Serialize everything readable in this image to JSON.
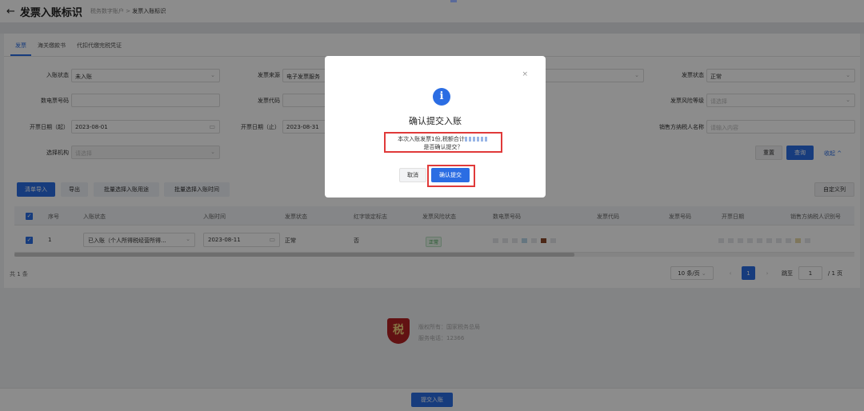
{
  "header": {
    "title": "发票入账标识",
    "breadcrumb_parent": "税务数字账户",
    "breadcrumb_sep": ">",
    "breadcrumb_current": "发票入账标识"
  },
  "tabs": [
    {
      "label": "发票"
    },
    {
      "label": "海关缴款书"
    },
    {
      "label": "代扣代缴完税凭证"
    }
  ],
  "filters": {
    "entry_status_label": "入账状态",
    "entry_status_value": "未入账",
    "invoice_source_label": "发票来源",
    "invoice_source_value": "电子发票服务",
    "invoice_status_label": "发票状态",
    "invoice_status_value": "正常",
    "digital_invoice_no_label": "数电票号码",
    "invoice_code_label": "发票代码",
    "risk_level_label": "发票风险等级",
    "risk_level_placeholder": "请选择",
    "date_start_label": "开票日期（起）",
    "date_start_value": "2023-08-01",
    "date_end_label": "开票日期（止）",
    "date_end_value": "2023-08-31",
    "seller_name_label": "销售方纳税人名称",
    "seller_name_placeholder": "请输入内容",
    "org_label": "选择机构",
    "org_placeholder": "请选择"
  },
  "actions": {
    "reset": "重置",
    "query": "查询",
    "collapse": "收起 ^"
  },
  "toolbar": {
    "import": "清单导入",
    "export": "导出",
    "batch_usage": "批量选择入账用途",
    "batch_time": "批量选择入账时间",
    "custom_columns": "自定义列"
  },
  "table": {
    "headers": [
      "序号",
      "入账状态",
      "入账时间",
      "发票状态",
      "红字锁定标志",
      "发票风险状态",
      "数电票号码",
      "发票代码",
      "发票号码",
      "开票日期",
      "销售方纳税人识别号"
    ],
    "rows": [
      {
        "index": "1",
        "entry_status": "已入账（个人所得税经营所得...",
        "entry_time": "2023-08-11",
        "invoice_status": "正常",
        "red_lock": "否",
        "risk_status": "正常"
      }
    ]
  },
  "pagination": {
    "total": "共 1 条",
    "page_size": "10 条/页",
    "current": "1",
    "jump_label": "跳至",
    "jump_value": "1",
    "pages": "/ 1 页"
  },
  "footer": {
    "logo_text": "税",
    "copyright": "版权所有：国家税务总局",
    "hotline": "服务电话：12366"
  },
  "submit_button": "提交入账",
  "modal": {
    "title": "确认提交入账",
    "line1": "本次入账发票1份,税额合计",
    "line2": "是否确认提交？",
    "cancel": "取消",
    "confirm": "确认提交",
    "close": "×"
  },
  "colors": {
    "primary": "#2b6de3",
    "highlight": "#e03a3a",
    "success": "#3a9c4a"
  }
}
